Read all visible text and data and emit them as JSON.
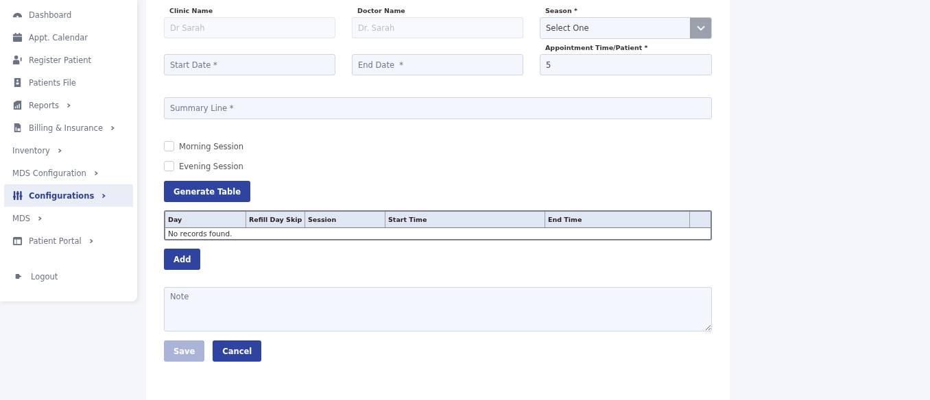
{
  "sidebar": {
    "items": [
      {
        "label": "Dashboard",
        "selected": false,
        "has_submenu": false
      },
      {
        "label": "Appt. Calendar",
        "selected": false,
        "has_submenu": false
      },
      {
        "label": "Register Patient",
        "selected": false,
        "has_submenu": false
      },
      {
        "label": "Patients File",
        "selected": false,
        "has_submenu": false
      },
      {
        "label": "Reports",
        "selected": false,
        "has_submenu": true
      },
      {
        "label": "Billing & Insurance",
        "selected": false,
        "has_submenu": true
      },
      {
        "label": "Inventory",
        "selected": false,
        "has_submenu": true
      },
      {
        "label": "MDS Configuration",
        "selected": false,
        "has_submenu": true
      },
      {
        "label": "Configurations",
        "selected": true,
        "has_submenu": true
      },
      {
        "label": "MDS",
        "selected": false,
        "has_submenu": true
      },
      {
        "label": "Patient Portal",
        "selected": false,
        "has_submenu": true
      }
    ],
    "logout": "Logout"
  },
  "form": {
    "fields": [
      {
        "kind": "text",
        "label": "Clinic Name",
        "placeholder": "Dr Sarah",
        "disabled": true
      },
      {
        "kind": "text",
        "label": "Doctor Name",
        "placeholder": "Dr. Sarah",
        "disabled": true
      },
      {
        "kind": "select",
        "label": "Season *",
        "placeholder": "Select One",
        "disabled": false
      },
      {
        "kind": "text",
        "placeholder": "Start Date *",
        "disabled": false
      },
      {
        "kind": "text",
        "placeholder": "End Date  *",
        "disabled": false
      },
      {
        "kind": "text",
        "label": "Appointment Time/Patient  *",
        "value": "5",
        "disabled": false
      }
    ],
    "summary": {
      "placeholder": "Summary Line *"
    },
    "checkboxes": [
      {
        "label": "Morning Session",
        "checked": false
      },
      {
        "label": "Evening Session",
        "checked": false
      }
    ],
    "generate_button": "Generate Table",
    "table": {
      "columns": [
        "Day",
        "Refill Day Skip",
        "Session",
        "Start Time",
        "End Time",
        ""
      ],
      "empty_message": "No records found."
    },
    "add_button": "Add",
    "note": {
      "placeholder": "Note"
    },
    "buttons": [
      {
        "label": "Save",
        "disabled": true
      },
      {
        "label": "Cancel",
        "disabled": false
      }
    ]
  }
}
